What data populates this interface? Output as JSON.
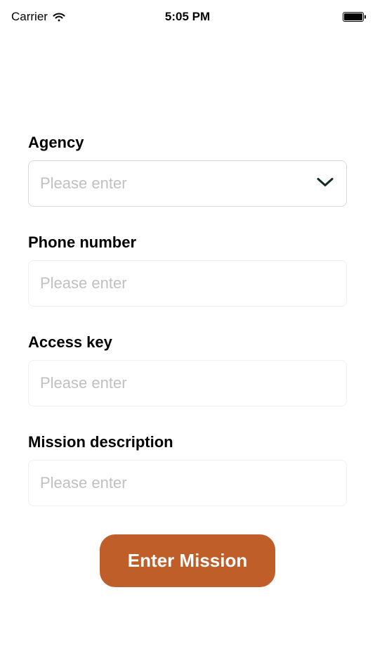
{
  "status_bar": {
    "carrier": "Carrier",
    "time": "5:05 PM"
  },
  "form": {
    "agency": {
      "label": "Agency",
      "placeholder": "Please enter",
      "value": ""
    },
    "phone": {
      "label": "Phone number",
      "placeholder": "Please enter",
      "value": ""
    },
    "access_key": {
      "label": "Access key",
      "placeholder": "Please enter",
      "value": ""
    },
    "mission": {
      "label": "Mission description",
      "placeholder": "Please enter",
      "value": ""
    }
  },
  "submit_button": "Enter Mission"
}
